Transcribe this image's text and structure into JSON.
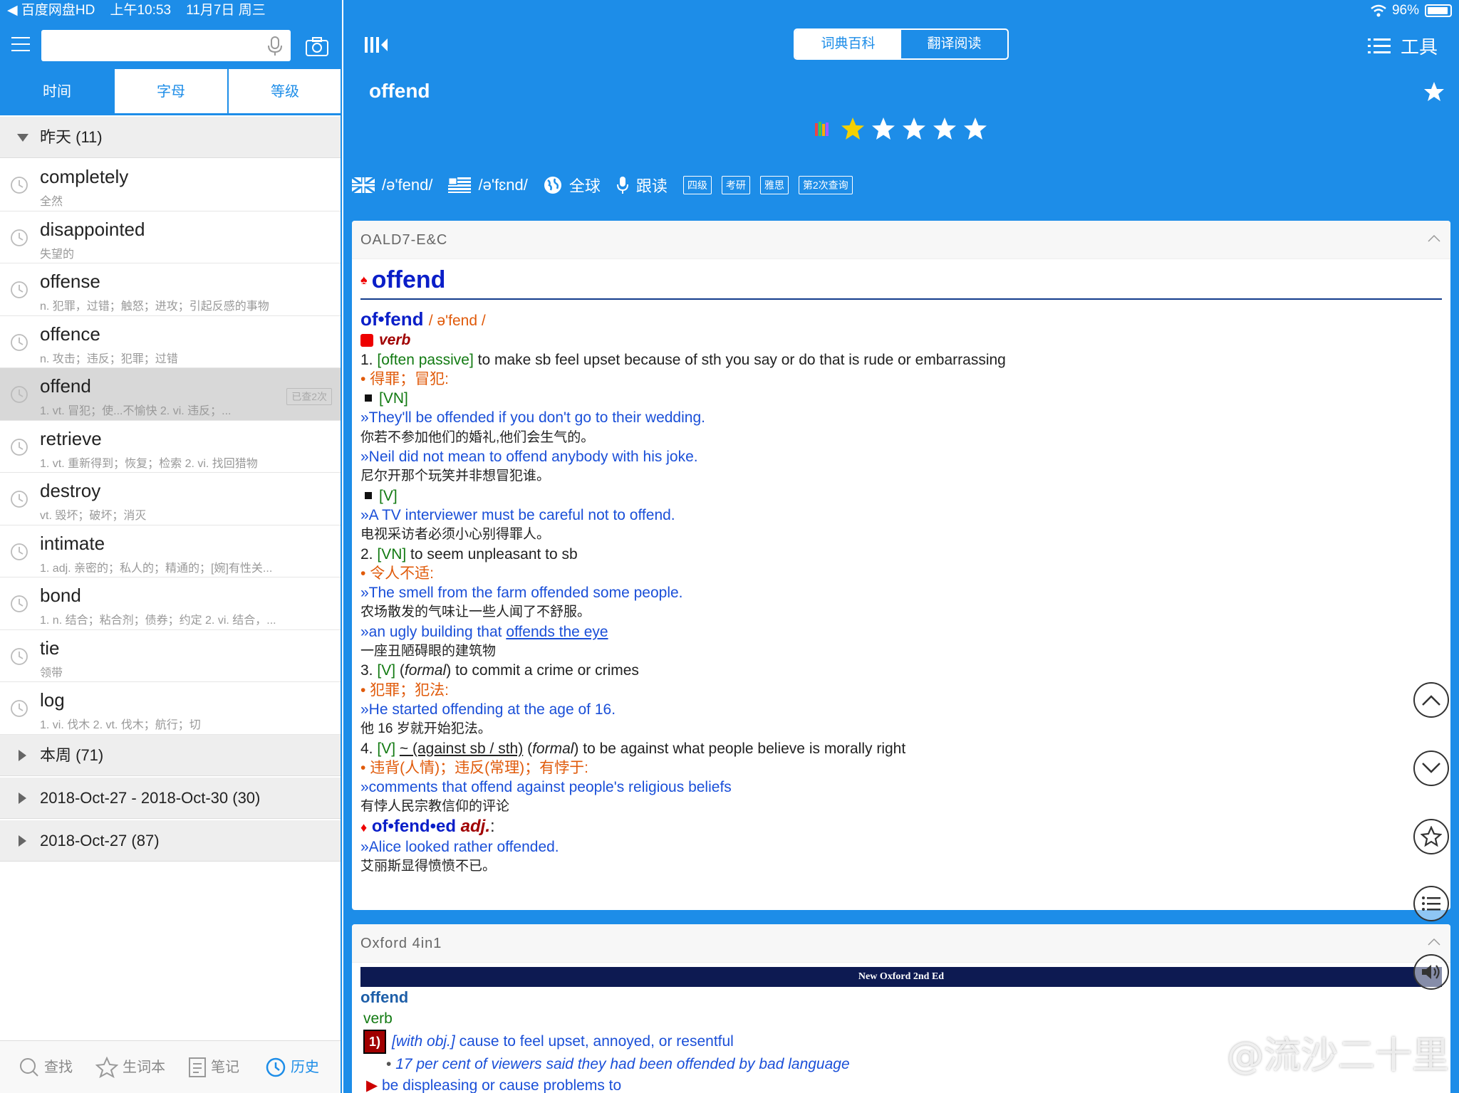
{
  "status_bar": {
    "back_app": "◀ 百度网盘HD",
    "time": "上午10:53",
    "date": "11月7日 周三",
    "battery": "96%"
  },
  "search": {
    "value": "",
    "placeholder": ""
  },
  "sort_tabs": [
    {
      "label": "时间",
      "active": true
    },
    {
      "label": "字母",
      "active": false
    },
    {
      "label": "等级",
      "active": false
    }
  ],
  "history": {
    "group_yesterday": "昨天 (11)",
    "items": [
      {
        "word": "completely",
        "def": "全然"
      },
      {
        "word": "disappointed",
        "def": "失望的"
      },
      {
        "word": "offense",
        "def": "n. 犯罪，过错；触怒；进攻；引起反感的事物"
      },
      {
        "word": "offence",
        "def": "n. 攻击；违反；犯罪；过错"
      },
      {
        "word": "offend",
        "def": "1. vt. 冒犯；使...不愉快 2. vi. 违反；...",
        "badge": "已查2次",
        "selected": true
      },
      {
        "word": "retrieve",
        "def": "1. vt. 重新得到；恢复；检索 2. vi. 找回猎物"
      },
      {
        "word": "destroy",
        "def": "vt. 毁坏；破坏；消灭"
      },
      {
        "word": "intimate",
        "def": "1. adj. 亲密的；私人的；精通的；[婉]有性关..."
      },
      {
        "word": "bond",
        "def": "1. n. 结合；粘合剂；债券；约定 2. vi. 结合，..."
      },
      {
        "word": "tie",
        "def": "领带"
      },
      {
        "word": "log",
        "def": "1. vi. 伐木 2. vt. 伐木；航行；切"
      }
    ],
    "groups_collapsed": [
      "本周 (71)",
      "2018-Oct-27 - 2018-Oct-30 (30)",
      "2018-Oct-27 (87)"
    ]
  },
  "bottom_tabs": [
    {
      "label": "查找",
      "icon": "search-icon"
    },
    {
      "label": "生词本",
      "icon": "star-outline-icon"
    },
    {
      "label": "笔记",
      "icon": "note-icon"
    },
    {
      "label": "历史",
      "icon": "clock-icon",
      "active": true
    }
  ],
  "header": {
    "segment": [
      {
        "label": "词典百科",
        "active": true
      },
      {
        "label": "翻译阅读",
        "active": false
      }
    ],
    "tools_label": "工具",
    "headword": "offend",
    "rating": 1,
    "rating_max": 5
  },
  "pronunciation": {
    "uk": "/ə'fend/",
    "us": "/ə'fɛnd/",
    "global": "全球",
    "follow": "跟读",
    "tags": [
      "四级",
      "考研",
      "雅思",
      "第2次查询"
    ]
  },
  "oald": {
    "source": "OALD7-E&C",
    "headword": "offend",
    "syllab": "of•fend",
    "phon": "/ ə'fend /",
    "pos": "verb",
    "s1_num": "1.",
    "s1_gram": "[often passive]",
    "s1_def": "to make sb feel upset because of sth you say or do that is rude or embarrassing",
    "s1_zh": "得罪；冒犯:",
    "s1_vn": "[VN]",
    "s1_ex1": "»They'll be offended if you don't go to their wedding.",
    "s1_ex1_zh": "你若不参加他们的婚礼,他们会生气的。",
    "s1_ex2": "»Neil did not mean to offend anybody with his joke.",
    "s1_ex2_zh": "尼尔开那个玩笑并非想冒犯谁。",
    "s1_v": "[V]",
    "s1_ex3": "»A TV interviewer must be careful not to offend.",
    "s1_ex3_zh": "电视采访者必须小心别得罪人。",
    "s2_num": "2.",
    "s2_gram": "[VN]",
    "s2_def": "to seem unpleasant to sb",
    "s2_zh": "令人不适:",
    "s2_ex1": "»The smell from the farm offended some people.",
    "s2_ex1_zh": "农场散发的气味让一些人闻了不舒服。",
    "s2_ex2_pre": "»an ugly building that ",
    "s2_ex2_link": "offends the eye",
    "s2_ex2_zh": "一座丑陋碍眼的建筑物",
    "s3_num": "3.",
    "s3_gram": "[V]",
    "s3_reg": "formal",
    "s3_def": "to commit a crime or crimes",
    "s3_zh": "犯罪；犯法:",
    "s3_ex1": "»He started offending at the age of 16.",
    "s3_ex1_zh": "他 16 岁就开始犯法。",
    "s4_num": "4.",
    "s4_gram": "[V]",
    "s4_pat": "~ (against sb / sth)",
    "s4_reg": "formal",
    "s4_def": "to be against what people believe is morally right",
    "s4_zh": "违背(人情)；违反(常理)；有悖于:",
    "s4_ex1": "»comments that offend against people's religious beliefs",
    "s4_ex1_zh": "有悖人民宗教信仰的评论",
    "deriv": "of•fend•ed",
    "deriv_pos": "adj.",
    "deriv_ex": "»Alice looked rather offended.",
    "deriv_ex_zh": "艾丽斯显得愤愤不已。"
  },
  "oxford4in1": {
    "source": "Oxford 4in1",
    "bar": "New Oxford 2nd Ed",
    "headword": "offend",
    "pos": "verb",
    "sense_num": "1)",
    "sense_gram": "[with obj.]",
    "sense_def": "cause to feel upset, annoyed, or resentful",
    "sense_ex": "17 per cent of viewers said they had been offended by bad language",
    "sense2": "be displeasing or cause problems to"
  },
  "watermark": "@流沙二十里",
  "colors": {
    "accent": "#1d8de8",
    "headword_blue": "#0a1ec8",
    "green": "#127a12",
    "orange": "#e05a0a"
  }
}
